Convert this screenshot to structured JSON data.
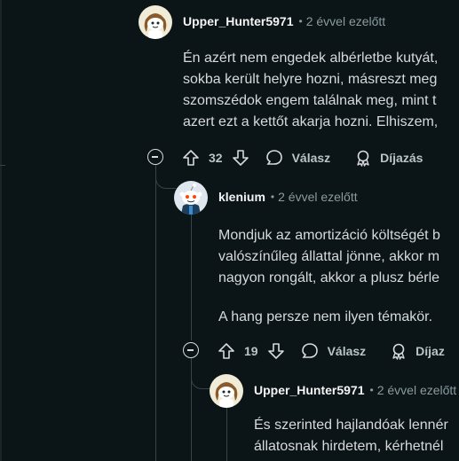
{
  "comments": [
    {
      "username": "Upper_Hunter5971",
      "separator": "•",
      "timestamp": "2 évvel ezelőtt",
      "lines": [
        "Én azért nem engedek albérletbe kutyát,",
        "sokba került helyre hozni, másreszt meg",
        "szomszédok engem találnak meg, mint t",
        "azert ezt a kettőt akarja hozni. Elhiszem,"
      ],
      "votes": "32",
      "reply_label": "Válasz",
      "award_label": "Díjazás"
    },
    {
      "username": "klenium",
      "separator": "•",
      "timestamp": "2 évvel ezelőtt",
      "lines": [
        "Mondjuk az amortizáció költségét b",
        "valószínűleg állattal jönne, akkor m",
        "nagyon rongált, akkor a plusz bérle"
      ],
      "extra_paragraph": "A hang persze nem ilyen témakör.",
      "votes": "19",
      "reply_label": "Válasz",
      "award_label": "Díjaz"
    },
    {
      "username": "Upper_Hunter5971",
      "separator": "•",
      "timestamp": "2 évvel ezelőtt",
      "lines": [
        "És szerinted hajlandóak lennér",
        "állatosnak hirdetem, kérhetnél"
      ]
    }
  ],
  "icons": {
    "collapse": "collapse-thread-icon",
    "upvote": "upvote-arrow-icon",
    "downvote": "downvote-arrow-icon",
    "reply": "speech-bubble-icon",
    "award": "award-ribbon-icon"
  },
  "colors": {
    "background": "#0b1416",
    "thread_line": "#33464c",
    "muted_text": "#8a9ba0"
  }
}
